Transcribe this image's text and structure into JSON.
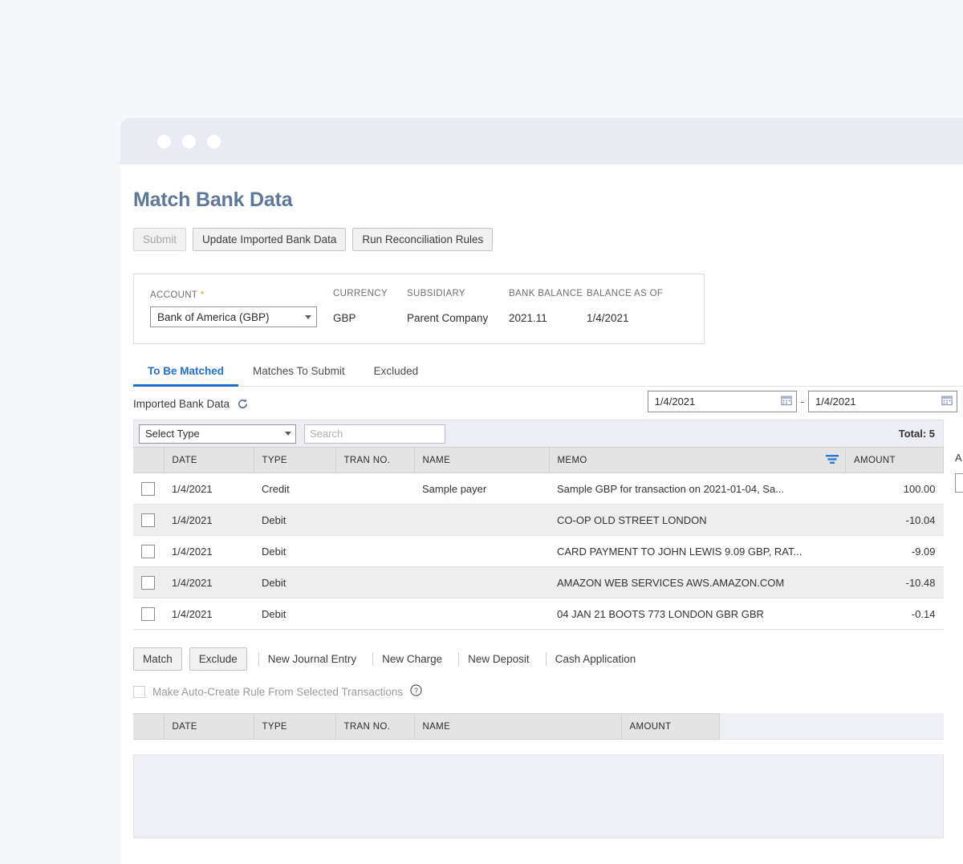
{
  "window": {
    "dots": [
      "dot",
      "dot",
      "dot"
    ]
  },
  "page": {
    "title": "Match Bank Data"
  },
  "toolbar": {
    "submit_label": "Submit",
    "update_label": "Update Imported Bank Data",
    "run_rules_label": "Run Reconciliation Rules"
  },
  "account_panel": {
    "labels": {
      "account": "ACCOUNT",
      "required_mark": "*",
      "currency": "CURRENCY",
      "subsidiary": "SUBSIDIARY",
      "bank_balance": "BANK BALANCE",
      "balance_as_of": "BALANCE AS OF"
    },
    "values": {
      "account": "Bank of America (GBP)",
      "currency": "GBP",
      "subsidiary": "Parent Company",
      "bank_balance": "2021.11",
      "balance_as_of": "1/4/2021"
    }
  },
  "tabs": [
    {
      "label": "To Be Matched",
      "active": true
    },
    {
      "label": "Matches To Submit",
      "active": false
    },
    {
      "label": "Excluded",
      "active": false
    }
  ],
  "imported": {
    "label": "Imported Bank Data",
    "refresh_icon": "refresh-icon",
    "date_from": "1/4/2021",
    "date_to": "1/4/2021",
    "date_separator": "-",
    "calendar_icon": "calendar-icon"
  },
  "filter_bar": {
    "type_select_value": "Select Type",
    "search_placeholder": "Search",
    "search_value": "",
    "total_label": "Total: 5"
  },
  "transactions_table": {
    "columns": [
      "DATE",
      "TYPE",
      "TRAN NO.",
      "NAME",
      "MEMO",
      "AMOUNT"
    ],
    "memo_filter_icon": "filter-icon",
    "rows": [
      {
        "date": "1/4/2021",
        "type": "Credit",
        "tran_no": "",
        "name": "Sample payer",
        "memo": "Sample GBP for transaction on 2021-01-04, Sa...",
        "amount": "100.00"
      },
      {
        "date": "1/4/2021",
        "type": "Debit",
        "tran_no": "",
        "name": "",
        "memo": "CO-OP OLD STREET LONDON",
        "amount": "-10.04"
      },
      {
        "date": "1/4/2021",
        "type": "Debit",
        "tran_no": "",
        "name": "",
        "memo": "CARD PAYMENT TO JOHN LEWIS 9.09 GBP, RAT...",
        "amount": "-9.09"
      },
      {
        "date": "1/4/2021",
        "type": "Debit",
        "tran_no": "",
        "name": "",
        "memo": "AMAZON WEB SERVICES AWS.AMAZON.COM",
        "amount": "-10.48"
      },
      {
        "date": "1/4/2021",
        "type": "Debit",
        "tran_no": "",
        "name": "",
        "memo": "04 JAN 21 BOOTS 773 LONDON GBR GBR",
        "amount": "-0.14"
      }
    ]
  },
  "mid_actions": {
    "match_label": "Match",
    "exclude_label": "Exclude",
    "links": [
      "New Journal Entry",
      "New Charge",
      "New Deposit",
      "Cash Application"
    ],
    "autocreate_label": "Make Auto-Create Rule From Selected Transactions",
    "help_icon": "help-icon"
  },
  "matches_table": {
    "columns": [
      "DATE",
      "TYPE",
      "TRAN NO.",
      "NAME",
      "AMOUNT"
    ],
    "rows": []
  },
  "side_cut": {
    "partial_label": "A"
  },
  "colors": {
    "page_background": "#f5f7fa",
    "window_chrome": "#e8ebf2",
    "title": "#5d7898",
    "accent": "#1f6fd0",
    "header_row": "#e4e4e4",
    "stripe_row": "#eeeeee",
    "required_star": "#e8a33d"
  }
}
